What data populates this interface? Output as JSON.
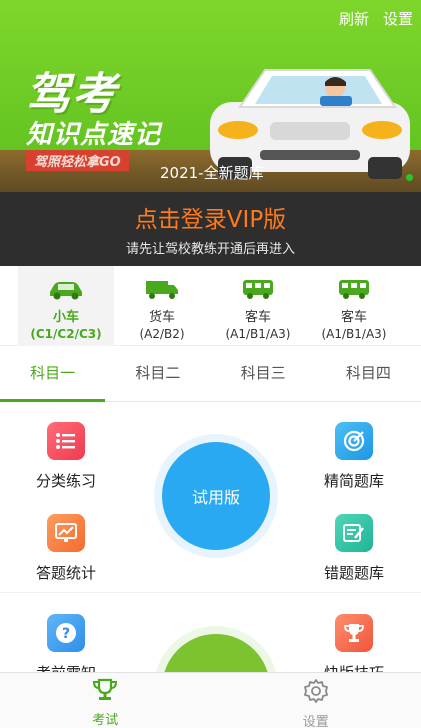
{
  "header": {
    "refresh_label": "刷新",
    "settings_label": "设置"
  },
  "banner": {
    "title_line1": "驾考",
    "title_line2": "知识点速记",
    "tagline": "驾照轻松拿GO",
    "subtitle": "2021-全新题库"
  },
  "vip": {
    "title": "点击登录VIP版",
    "subtitle": "请先让驾校教练开通后再进入"
  },
  "vehicles": [
    {
      "name": "小车",
      "classes": "(C1/C2/C3)",
      "icon": "car-icon",
      "active": true
    },
    {
      "name": "货车",
      "classes": "(A2/B2)",
      "icon": "truck-icon",
      "active": false
    },
    {
      "name": "客车",
      "classes": "(A1/B1/A3)",
      "icon": "bus-icon",
      "active": false
    },
    {
      "name": "客车",
      "classes": "(A1/B1/A3)",
      "icon": "bus-icon",
      "active": false
    }
  ],
  "subjects": [
    "科目一",
    "科目二",
    "科目三",
    "科目四"
  ],
  "active_subject": 0,
  "features": {
    "category_practice": "分类练习",
    "answer_stats": "答题统计",
    "exam_notes": "考前需知",
    "concise_bank": "精简题库",
    "wrong_bank": "错题题库",
    "quick_tips": "快版技巧",
    "trial_label": "试用版"
  },
  "nav": {
    "exam_label": "考试",
    "settings_label": "设置"
  },
  "colors": {
    "accent": "#4aa81e",
    "banner_green": "#6ccb25",
    "vip_bg": "#2e2e2e",
    "vip_orange": "#ff7a1a",
    "trial_blue": "#29a9f1"
  }
}
